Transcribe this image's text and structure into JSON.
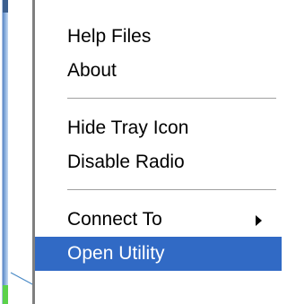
{
  "menu": {
    "groups": [
      {
        "items": [
          {
            "label": "Help Files"
          },
          {
            "label": "About"
          }
        ]
      },
      {
        "items": [
          {
            "label": "Hide Tray Icon"
          },
          {
            "label": "Disable Radio"
          }
        ]
      },
      {
        "items": [
          {
            "label": "Connect To",
            "has_submenu": true
          },
          {
            "label": "Open Utility",
            "selected": true
          }
        ]
      }
    ]
  },
  "icons": {
    "submenu_arrow": "chevron-right-icon"
  },
  "colors": {
    "selection_background": "#316ac5",
    "selection_text": "#ffffff",
    "menu_text": "#000000",
    "separator": "#a0a0a0",
    "pointer_line": "#4a8ac6"
  }
}
